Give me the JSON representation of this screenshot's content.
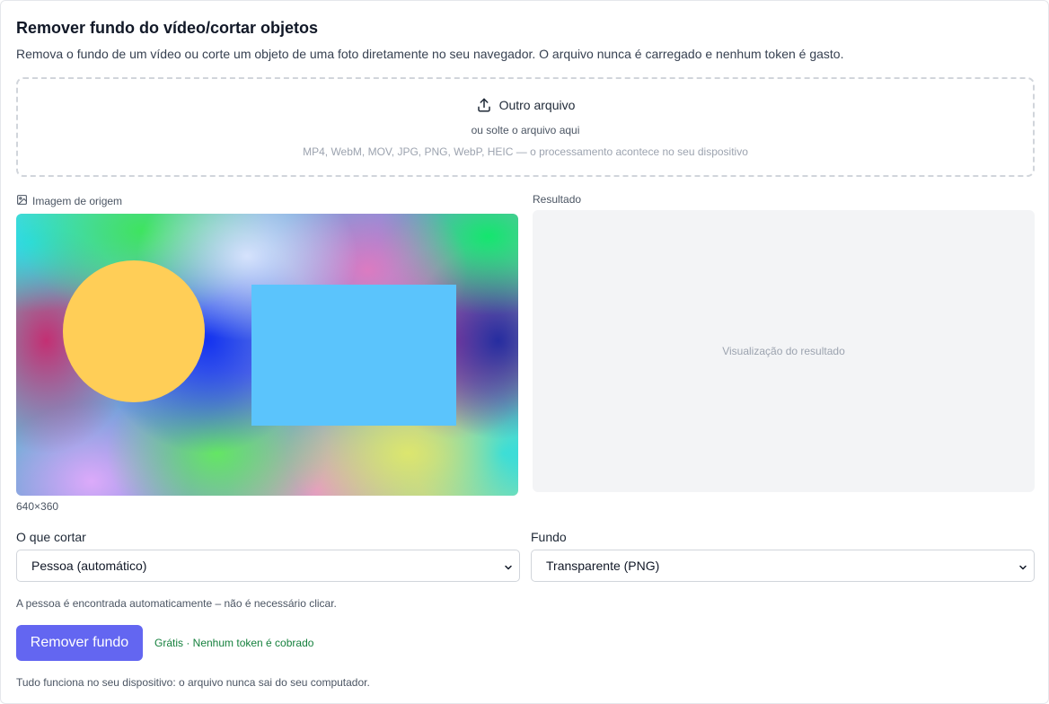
{
  "header": {
    "title": "Remover fundo do vídeo/cortar objetos",
    "subtitle": "Remova o fundo de um vídeo ou corte um objeto de uma foto diretamente no seu navegador. O arquivo nunca é carregado e nenhum token é gasto."
  },
  "dropzone": {
    "button_label": "Outro arquivo",
    "button_icon": "upload-icon",
    "drop_hint": "ou solte o arquivo aqui",
    "formats": "MP4, WebM, MOV, JPG, PNG, WebP, HEIC — o processamento acontece no seu dispositivo"
  },
  "source": {
    "label": "Imagem de origem",
    "icon": "image-icon",
    "dimensions": "640×360",
    "shape_colors": {
      "circle": "#ffce57",
      "rectangle": "#5bc4fc"
    }
  },
  "result": {
    "label": "Resultado",
    "placeholder": "Visualização do resultado"
  },
  "controls": {
    "cut_label": "O que cortar",
    "cut_value": "Pessoa (automático)",
    "background_label": "Fundo",
    "background_value": "Transparente (PNG)",
    "hint": "A pessoa é encontrada automaticamente – não é necessário clicar."
  },
  "action": {
    "button_label": "Remover fundo",
    "free_note": "Grátis · Nenhum token é cobrado",
    "accent_color": "#6366f1",
    "free_color": "#15803d"
  },
  "footer": {
    "note": "Tudo funciona no seu dispositivo: o arquivo nunca sai do seu computador."
  }
}
